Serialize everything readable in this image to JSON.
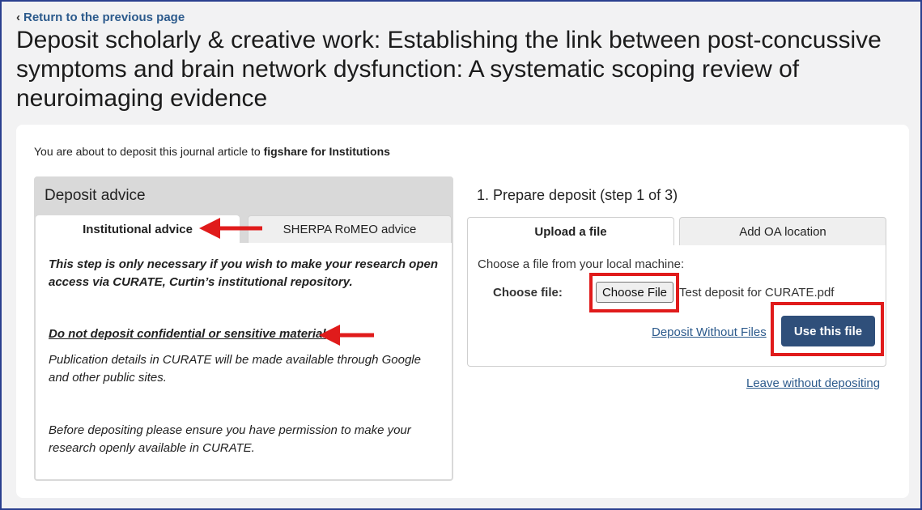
{
  "nav": {
    "back_label": "Return to the previous page"
  },
  "page": {
    "title": "Deposit scholarly & creative work: Establishing the link between post-concussive symptoms and brain network dysfunction: A systematic scoping review of neuroimaging evidence"
  },
  "intro": {
    "prefix": "You are about to deposit this journal article to ",
    "target": "figshare for Institutions"
  },
  "advice": {
    "heading": "Deposit advice",
    "tabs": [
      {
        "label": "Institutional advice",
        "active": true
      },
      {
        "label": "SHERPA RoMEO advice",
        "active": false
      }
    ],
    "paragraphs": [
      "This step is only necessary if you wish to make your research open access via CURATE, Curtin’s institutional repository.",
      "Do not deposit confidential or sensitive material",
      "Publication details in CURATE will be made available through Google and other public sites.",
      "Before depositing please ensure you have permission to make your research openly available in CURATE."
    ]
  },
  "deposit": {
    "step_title": "1. Prepare deposit (step 1 of 3)",
    "tabs": [
      {
        "label": "Upload a file",
        "active": true
      },
      {
        "label": "Add OA location",
        "active": false
      }
    ],
    "instruction": "Choose a file from your local machine:",
    "choose_label": "Choose file:",
    "choose_button": "Choose File",
    "file_name": "Test deposit for CURATE.pdf",
    "without_files_link": "Deposit Without Files",
    "use_button": "Use this file",
    "leave_link": "Leave without depositing"
  },
  "colors": {
    "accent": "#2f4f7a",
    "link": "#2c5a8c",
    "highlight": "#e01b1b"
  }
}
